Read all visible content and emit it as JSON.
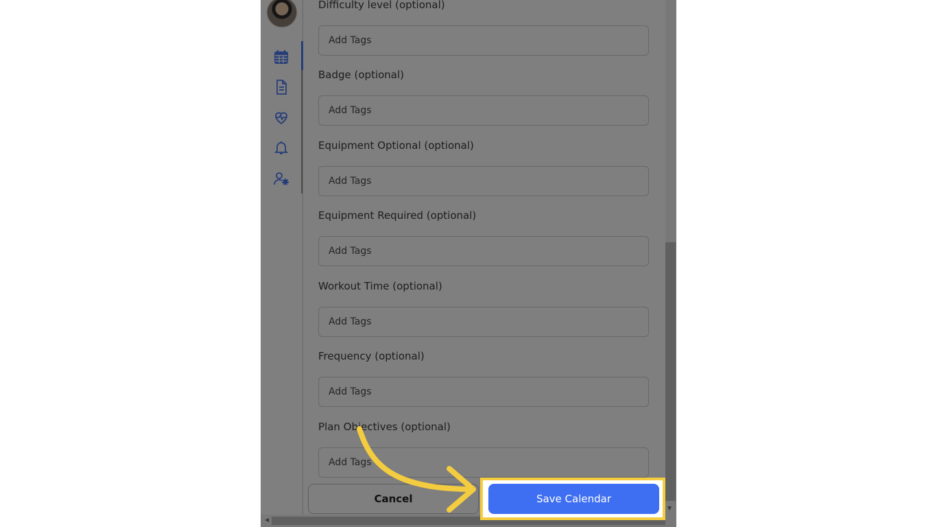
{
  "form": {
    "fields": [
      {
        "label": "Difficulty level (optional)",
        "placeholder": "Add Tags"
      },
      {
        "label": "Badge (optional)",
        "placeholder": "Add Tags"
      },
      {
        "label": "Equipment Optional (optional)",
        "placeholder": "Add Tags"
      },
      {
        "label": "Equipment Required (optional)",
        "placeholder": "Add Tags"
      },
      {
        "label": "Workout Time (optional)",
        "placeholder": "Add Tags"
      },
      {
        "label": "Frequency (optional)",
        "placeholder": "Add Tags"
      },
      {
        "label": "Plan Objectives (optional)",
        "placeholder": "Add Tags"
      }
    ]
  },
  "actions": {
    "cancel_label": "Cancel",
    "save_label": "Save Calendar"
  },
  "sidebar": {
    "icons": [
      "calendar-icon",
      "document-icon",
      "heart-pulse-icon",
      "bell-icon",
      "user-settings-icon"
    ],
    "active": "calendar-icon"
  },
  "colors": {
    "accent": "#3e6ef2",
    "highlight": "#f4cc3f",
    "icon": "#4a7af0"
  }
}
